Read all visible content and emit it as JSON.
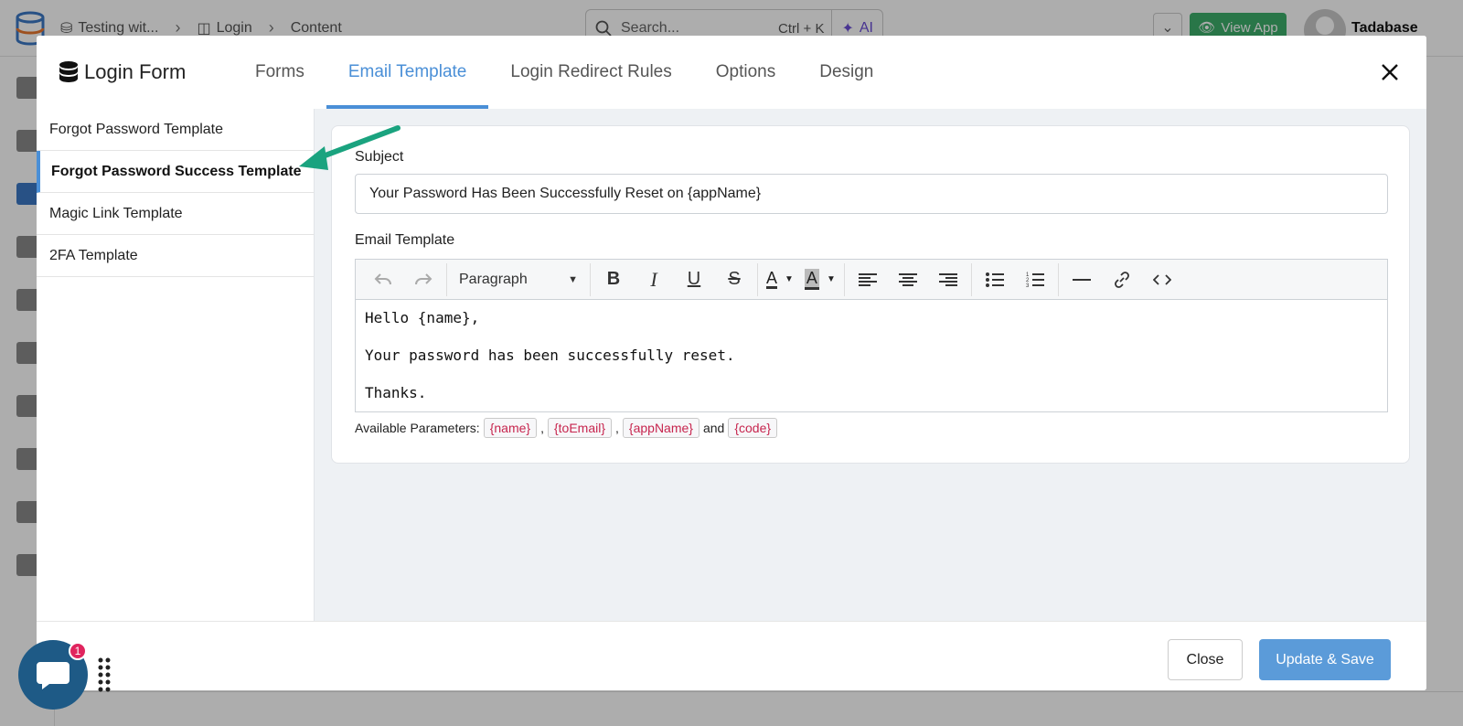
{
  "background": {
    "breadcrumbs": [
      "Testing wit...",
      "Login",
      "Content"
    ],
    "search_placeholder": "Search...",
    "search_shortcut": "Ctrl + K",
    "ai_label": "AI",
    "view_app_label": "View App",
    "user_name": "Tadabase"
  },
  "modal": {
    "title": "Login Form",
    "tabs": [
      {
        "label": "Forms",
        "active": false
      },
      {
        "label": "Email Template",
        "active": true
      },
      {
        "label": "Login Redirect Rules",
        "active": false
      },
      {
        "label": "Options",
        "active": false
      },
      {
        "label": "Design",
        "active": false
      }
    ],
    "templates": [
      {
        "label": "Forgot Password Template",
        "active": false
      },
      {
        "label": "Forgot Password Success Template",
        "active": true
      },
      {
        "label": "Magic Link Template",
        "active": false
      },
      {
        "label": "2FA Template",
        "active": false
      }
    ],
    "subject_label": "Subject",
    "subject_value": "Your Password Has Been Successfully Reset on {appName}",
    "email_template_label": "Email Template",
    "editor": {
      "format_select": "Paragraph",
      "body_lines": [
        "Hello {name},",
        "Your password has been successfully reset.",
        "Thanks."
      ]
    },
    "params_label": "Available Parameters:",
    "params": [
      "{name}",
      "{toEmail}",
      "{appName}",
      "{code}"
    ],
    "params_joiner": "and",
    "footer": {
      "close_label": "Close",
      "save_label": "Update & Save"
    }
  },
  "chat_badge_count": "1",
  "colors": {
    "accent": "#4a8fd7",
    "save_button": "#5b9bd9",
    "view_app_green": "#3dae6b",
    "param_red": "#c7254e",
    "arrow_teal": "#1aa37f"
  }
}
